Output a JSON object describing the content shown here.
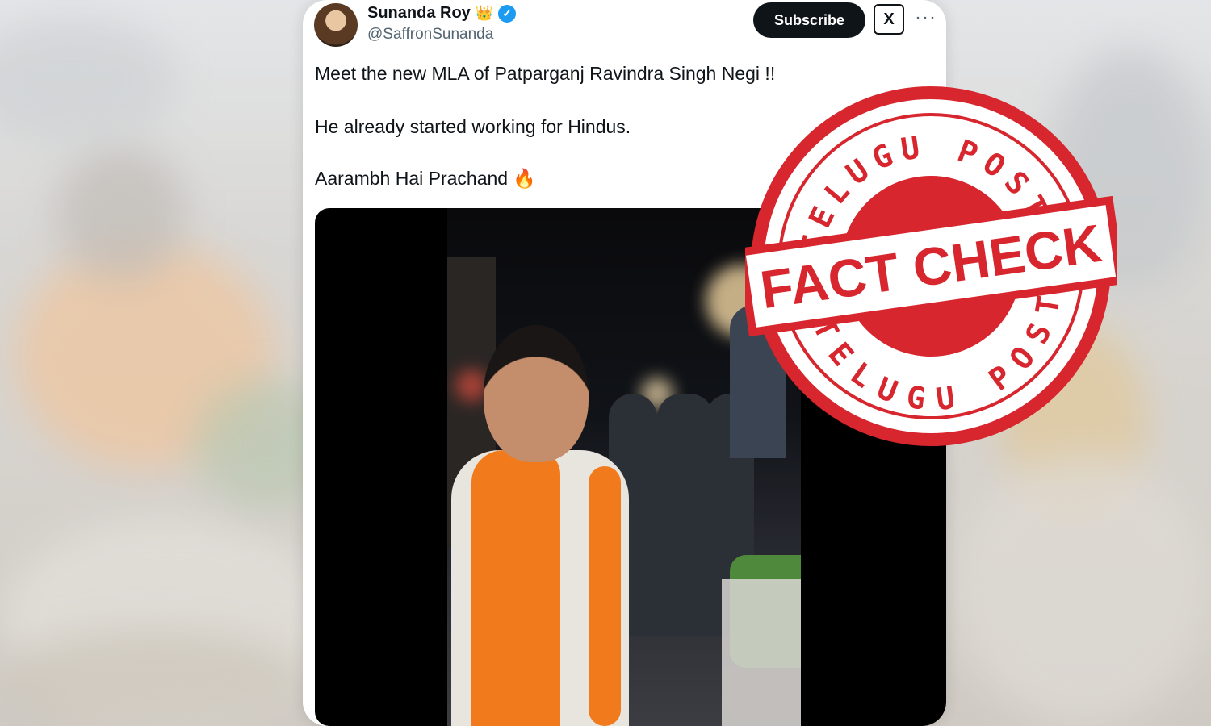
{
  "tweet": {
    "author_name": "Sunanda Roy",
    "author_badge": "👑",
    "handle": "@SaffronSunanda",
    "subscribe_label": "Subscribe",
    "grok_label": "X",
    "more_label": "···",
    "lines": [
      "Meet the new MLA of Patparganj Ravindra Singh Negi !!",
      "He already started working for Hindus.",
      "Aarambh Hai Prachand"
    ],
    "emoji": "🔥"
  },
  "stamp": {
    "top_arc": "TELUGU POST",
    "center": "FACT CHECK",
    "bottom_arc": "TELUGU POST",
    "color": "#d7262d"
  },
  "colors": {
    "verified": "#1d9bf0",
    "subscribe_bg": "#0f1419",
    "saffron": "#f07a1c"
  }
}
